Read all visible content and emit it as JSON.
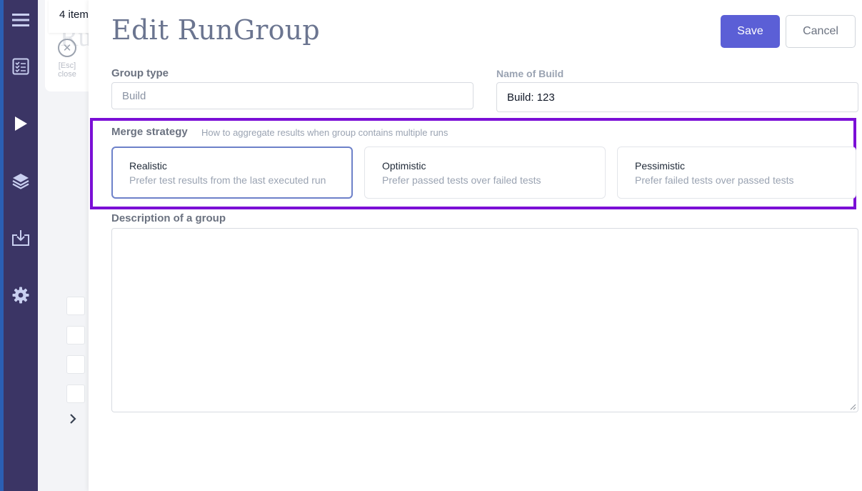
{
  "background": {
    "items_count": "4 item",
    "title_fragment": "Ru",
    "close": {
      "key": "[Esc]",
      "label": "close"
    }
  },
  "sidebar": {
    "icons": [
      "menu-icon",
      "checklist-icon",
      "play-icon",
      "layers-icon",
      "import-icon",
      "gear-icon"
    ]
  },
  "drawer": {
    "title": "Edit RunGroup",
    "save_label": "Save",
    "cancel_label": "Cancel",
    "group_type": {
      "label": "Group type",
      "value": "Build"
    },
    "name_of_build": {
      "label": "Name of Build",
      "value": "Build: 123"
    },
    "merge_strategy": {
      "label": "Merge strategy",
      "hint": "How to aggregate results when group contains multiple runs",
      "selected": "Realistic",
      "options": [
        {
          "title": "Realistic",
          "description": "Prefer test results from the last executed run"
        },
        {
          "title": "Optimistic",
          "description": "Prefer passed tests over failed tests"
        },
        {
          "title": "Pessimistic",
          "description": "Prefer failed tests over passed tests"
        }
      ]
    },
    "description": {
      "label": "Description of a group",
      "value": ""
    }
  },
  "colors": {
    "sidebar": "#3b3565",
    "accent": "#5b5fd6",
    "highlight": "#7b0fd6",
    "selected_border": "#6d81c9"
  }
}
